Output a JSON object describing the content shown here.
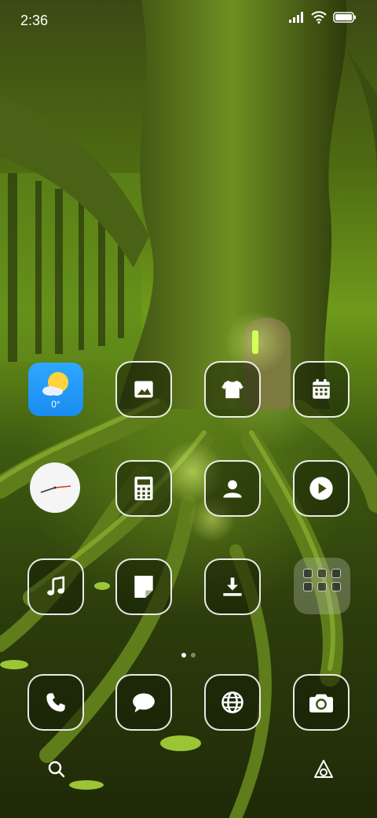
{
  "status_bar": {
    "time": "2:36",
    "icons": [
      "signal-icon",
      "wifi-icon",
      "battery-icon"
    ]
  },
  "weather_widget": {
    "temperature": "0°",
    "icon": "partly-cloudy-icon"
  },
  "clock_widget": {
    "icon": "analog-clock-icon"
  },
  "apps": [
    {
      "name": "gallery-icon"
    },
    {
      "name": "themes-icon"
    },
    {
      "name": "calendar-icon"
    },
    {
      "name": "calculator-icon"
    },
    {
      "name": "contacts-icon"
    },
    {
      "name": "video-player-icon"
    },
    {
      "name": "music-icon"
    },
    {
      "name": "notes-icon"
    },
    {
      "name": "downloads-icon"
    }
  ],
  "folder": {
    "icon": "app-folder-icon",
    "mini_icons": 6
  },
  "page_indicator": {
    "pages": 2,
    "current": 1
  },
  "dock": [
    {
      "name": "phone-icon"
    },
    {
      "name": "messages-icon"
    },
    {
      "name": "browser-icon"
    },
    {
      "name": "camera-icon"
    }
  ],
  "bottom_bar": {
    "left": "search-icon",
    "right": "assistant-icon"
  },
  "colors": {
    "weather_bg": "#1a8cf0",
    "tile_border": "#ffffff",
    "wallpaper_primary": "#4e6a12"
  }
}
